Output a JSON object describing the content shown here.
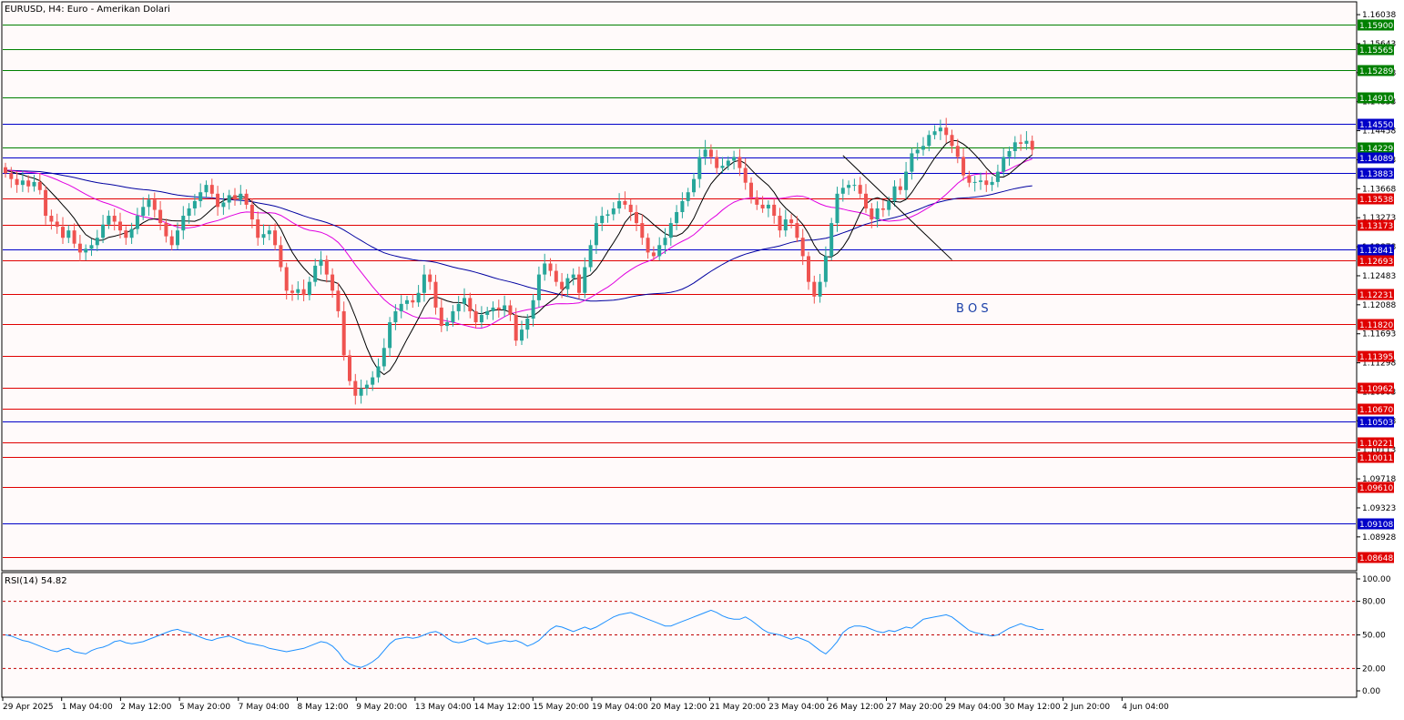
{
  "header": {
    "title": "EURUSD, H4:  Euro - Amerikan Dolari"
  },
  "annotation": {
    "label": "B O S"
  },
  "rsi": {
    "label": "RSI(14) 54.82",
    "value": 54.82,
    "levels": [
      80,
      50,
      20
    ],
    "axis_labels": [
      "100.00",
      "80.00",
      "50.00",
      "20.00",
      "0.00"
    ]
  },
  "colors": {
    "background": "#fffafa",
    "bull": "#26a69a",
    "bear": "#ef5350",
    "resistance": "#008000",
    "support": "#e00000",
    "pivot": "#0000c8",
    "ma_fast": "#000000",
    "ma_mid": "#e000e0",
    "ma_slow": "#0000a0",
    "rsi": "#1e90ff"
  },
  "chart_data": {
    "type": "candlestick",
    "symbol": "EURUSD",
    "timeframe": "H4",
    "ylim": [
      1.0848,
      1.162
    ],
    "y_ticks": [
      "1.16038",
      "1.15643",
      "1.15248",
      "1.14853",
      "1.14458",
      "1.14063",
      "1.13668",
      "1.13273",
      "1.12878",
      "1.12483",
      "1.12088",
      "1.11693",
      "1.11298",
      "1.10903",
      "1.10508",
      "1.10113",
      "1.09718",
      "1.09323",
      "1.08928"
    ],
    "x_tick_labels": [
      "29 Apr 2025",
      "1 May 04:00",
      "2 May 12:00",
      "5 May 20:00",
      "7 May 04:00",
      "8 May 12:00",
      "9 May 20:00",
      "13 May 04:00",
      "14 May 12:00",
      "15 May 20:00",
      "19 May 04:00",
      "20 May 12:00",
      "21 May 20:00",
      "23 May 04:00",
      "26 May 12:00",
      "27 May 20:00",
      "29 May 04:00",
      "30 May 12:00",
      "2 Jun 20:00",
      "4 Jun 04:00"
    ],
    "levels": [
      {
        "value": 1.159,
        "label": "1.15900",
        "kind": "resistance"
      },
      {
        "value": 1.15565,
        "label": "1.15565",
        "kind": "resistance"
      },
      {
        "value": 1.15289,
        "label": "1.15289",
        "kind": "resistance"
      },
      {
        "value": 1.1491,
        "label": "1.14910",
        "kind": "resistance"
      },
      {
        "value": 1.1455,
        "label": "1.14550",
        "kind": "pivot"
      },
      {
        "value": 1.14229,
        "label": "1.14229",
        "kind": "resistance"
      },
      {
        "value": 1.14089,
        "label": "1.14089",
        "kind": "pivot"
      },
      {
        "value": 1.13883,
        "label": "1.13883",
        "kind": "pivot"
      },
      {
        "value": 1.13538,
        "label": "1.13538",
        "kind": "support"
      },
      {
        "value": 1.13173,
        "label": "1.13173",
        "kind": "support"
      },
      {
        "value": 1.12841,
        "label": "1.12841",
        "kind": "pivot"
      },
      {
        "value": 1.12693,
        "label": "1.12693",
        "kind": "support"
      },
      {
        "value": 1.12231,
        "label": "1.12231",
        "kind": "support"
      },
      {
        "value": 1.1182,
        "label": "1.11820",
        "kind": "support"
      },
      {
        "value": 1.11395,
        "label": "1.11395",
        "kind": "support"
      },
      {
        "value": 1.10962,
        "label": "1.10962",
        "kind": "support"
      },
      {
        "value": 1.1067,
        "label": "1.10670",
        "kind": "support"
      },
      {
        "value": 1.10503,
        "label": "1.10503",
        "kind": "pivot"
      },
      {
        "value": 1.10221,
        "label": "1.10221",
        "kind": "support"
      },
      {
        "value": 1.10011,
        "label": "1.10011",
        "kind": "support"
      },
      {
        "value": 1.0961,
        "label": "1.09610",
        "kind": "support"
      },
      {
        "value": 1.09108,
        "label": "1.09108",
        "kind": "pivot"
      },
      {
        "value": 1.08648,
        "label": "1.08648",
        "kind": "support"
      }
    ],
    "candle_closes": [
      1.1388,
      1.138,
      1.1372,
      1.1378,
      1.137,
      1.1376,
      1.1365,
      1.133,
      1.1322,
      1.1315,
      1.13,
      1.131,
      1.1292,
      1.128,
      1.1285,
      1.129,
      1.13,
      1.1318,
      1.133,
      1.1322,
      1.131,
      1.13,
      1.1312,
      1.133,
      1.1342,
      1.1352,
      1.1338,
      1.132,
      1.1302,
      1.129,
      1.131,
      1.133,
      1.134,
      1.135,
      1.1362,
      1.1372,
      1.136,
      1.1342,
      1.1348,
      1.1358,
      1.1352,
      1.136,
      1.1345,
      1.1325,
      1.13,
      1.1305,
      1.131,
      1.129,
      1.126,
      1.1228,
      1.1225,
      1.123,
      1.1222,
      1.124,
      1.1262,
      1.127,
      1.125,
      1.1228,
      1.12,
      1.114,
      1.1105,
      1.1085,
      1.1095,
      1.11,
      1.111,
      1.1125,
      1.115,
      1.1185,
      1.12,
      1.121,
      1.1215,
      1.1212,
      1.1225,
      1.125,
      1.124,
      1.1205,
      1.118,
      1.1185,
      1.12,
      1.121,
      1.1218,
      1.12,
      1.1185,
      1.1195,
      1.12,
      1.1205,
      1.1202,
      1.1208,
      1.1195,
      1.116,
      1.1175,
      1.119,
      1.1215,
      1.125,
      1.1265,
      1.1255,
      1.124,
      1.123,
      1.1245,
      1.125,
      1.1225,
      1.126,
      1.129,
      1.132,
      1.133,
      1.1332,
      1.134,
      1.135,
      1.1345,
      1.1335,
      1.132,
      1.13,
      1.128,
      1.1275,
      1.129,
      1.13,
      1.132,
      1.1335,
      1.135,
      1.1362,
      1.138,
      1.141,
      1.142,
      1.141,
      1.1395,
      1.1398,
      1.1405,
      1.141,
      1.1395,
      1.1375,
      1.1355,
      1.1345,
      1.134,
      1.1345,
      1.133,
      1.131,
      1.1325,
      1.132,
      1.13,
      1.1275,
      1.124,
      1.122,
      1.124,
      1.1275,
      1.132,
      1.136,
      1.1368,
      1.1372,
      1.1372,
      1.136,
      1.134,
      1.1325,
      1.134,
      1.1338,
      1.135,
      1.137,
      1.1365,
      1.139,
      1.1415,
      1.142,
      1.1425,
      1.144,
      1.1445,
      1.145,
      1.144,
      1.1425,
      1.141,
      1.1385,
      1.1375,
      1.1376,
      1.1378,
      1.1372,
      1.1376,
      1.139,
      1.141,
      1.1418,
      1.143,
      1.1428,
      1.1432,
      1.142
    ],
    "rsi_values": [
      50,
      49,
      47,
      45,
      44,
      42,
      40,
      38,
      36,
      35,
      37,
      38,
      35,
      34,
      33,
      36,
      38,
      39,
      41,
      44,
      45,
      43,
      42,
      43,
      44,
      46,
      48,
      50,
      52,
      54,
      55,
      53,
      52,
      50,
      48,
      46,
      45,
      47,
      48,
      49,
      47,
      45,
      43,
      42,
      41,
      40,
      38,
      37,
      36,
      35,
      36,
      37,
      38,
      40,
      42,
      44,
      43,
      40,
      35,
      28,
      24,
      22,
      21,
      23,
      26,
      30,
      36,
      42,
      46,
      47,
      48,
      47,
      48,
      50,
      52,
      53,
      51,
      47,
      44,
      43,
      44,
      46,
      47,
      44,
      42,
      43,
      44,
      45,
      44,
      45,
      43,
      40,
      42,
      45,
      50,
      55,
      58,
      57,
      55,
      53,
      55,
      57,
      55,
      57,
      60,
      63,
      66,
      68,
      69,
      70,
      68,
      66,
      64,
      62,
      60,
      58,
      58,
      60,
      62,
      64,
      66,
      68,
      70,
      72,
      70,
      67,
      65,
      64,
      64,
      66,
      63,
      59,
      55,
      52,
      51,
      50,
      48,
      46,
      48,
      46,
      44,
      40,
      36,
      33,
      38,
      44,
      52,
      56,
      58,
      58,
      57,
      55,
      53,
      52,
      54,
      53,
      55,
      57,
      56,
      60,
      64,
      65,
      66,
      67,
      68,
      66,
      62,
      58,
      54,
      52,
      51,
      50,
      49,
      50,
      53,
      56,
      58,
      60,
      58,
      57,
      55,
      54.82
    ]
  }
}
